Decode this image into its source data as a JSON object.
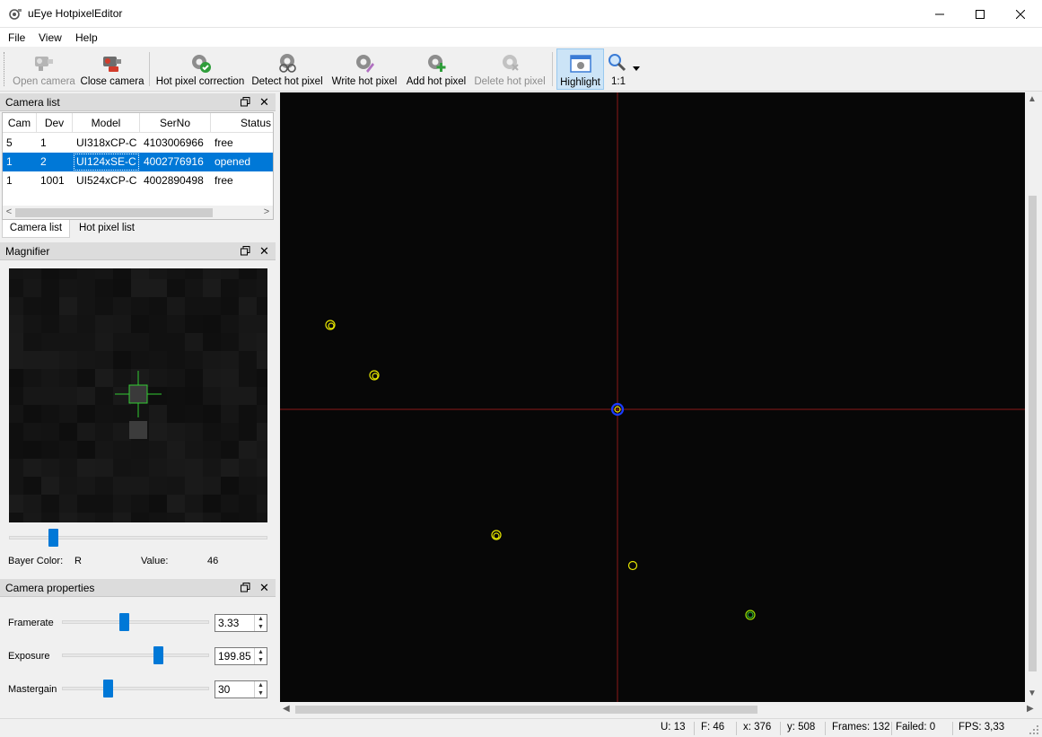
{
  "window": {
    "title": "uEye HotpixelEditor"
  },
  "menu": [
    "File",
    "View",
    "Help"
  ],
  "toolbar": {
    "items": [
      {
        "label": "Open camera",
        "icon": "camera-icon",
        "enabled": false
      },
      {
        "label": "Close camera",
        "icon": "camera-close-icon",
        "enabled": true
      },
      {
        "label": "Hot pixel correction",
        "icon": "gear-check-icon",
        "enabled": true
      },
      {
        "label": "Detect hot pixel",
        "icon": "gear-detect-icon",
        "enabled": true
      },
      {
        "label": "Write hot pixel",
        "icon": "gear-write-icon",
        "enabled": true
      },
      {
        "label": "Add hot pixel",
        "icon": "gear-add-icon",
        "enabled": true
      },
      {
        "label": "Delete hot pixel",
        "icon": "gear-delete-icon",
        "enabled": false
      },
      {
        "label": "Highlight",
        "icon": "highlight-icon",
        "enabled": true,
        "active": true
      }
    ],
    "zoom_label": "1:1"
  },
  "camera_list": {
    "title": "Camera list",
    "columns": [
      "Cam",
      "Dev",
      "Model",
      "SerNo",
      "Status"
    ],
    "rows": [
      [
        "5",
        "1",
        "UI318xCP-C",
        "4103006966",
        "free"
      ],
      [
        "1",
        "2",
        "UI124xSE-C",
        "4002776916",
        "opened"
      ],
      [
        "1",
        "1001",
        "UI524xCP-C",
        "4002890498",
        "free"
      ]
    ],
    "selected_row": 1,
    "tabs": [
      "Camera list",
      "Hot pixel list"
    ]
  },
  "magnifier": {
    "title": "Magnifier",
    "bayer_label": "Bayer Color:",
    "bayer_value": "R",
    "value_label": "Value:",
    "value": "46",
    "slider_level": 0.17
  },
  "camera_properties": {
    "title": "Camera properties",
    "items": [
      {
        "label": "Framerate",
        "value": "3.33",
        "slider_level": 0.42
      },
      {
        "label": "Exposure",
        "value": "199.85",
        "slider_level": 0.65
      },
      {
        "label": "Mastergain",
        "value": "30",
        "slider_level": 0.31
      }
    ]
  },
  "statusbar": {
    "u": "U: 13",
    "f": "F: 46",
    "x": "x: 376",
    "y": "y: 508",
    "frames": "Frames: 132",
    "failed": "Failed: 0",
    "fps": "FPS: 3,33"
  },
  "colors": {
    "selection": "#0078d7",
    "hotpixel_marker": "#e6e600",
    "crosshair": "#8b1a1a",
    "selected_marker": "#1a3cff",
    "magnifier_cross": "#33cc33"
  }
}
